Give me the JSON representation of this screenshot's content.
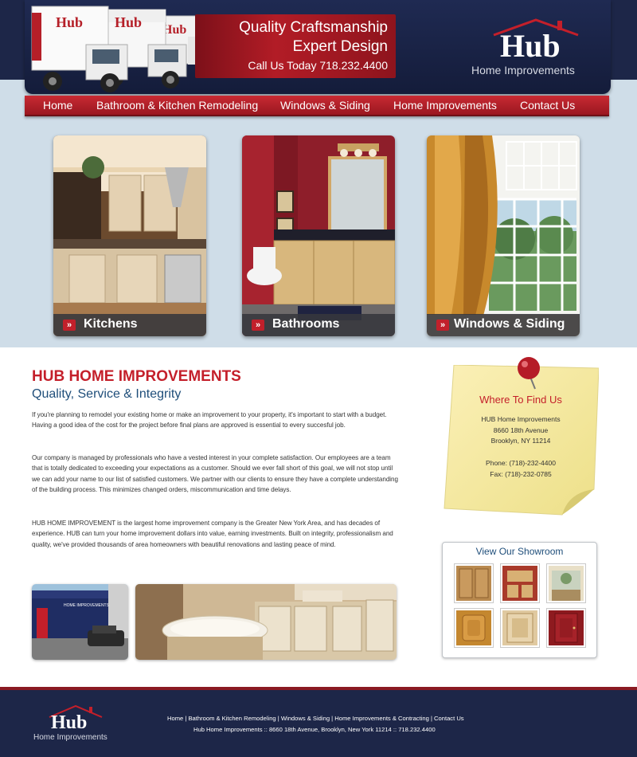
{
  "colors": {
    "navy": "#1d2648",
    "red": "#c41f2a",
    "nav_red": "#b3222b",
    "blue_heading": "#1f4e7a",
    "light_band": "#cfdde8"
  },
  "header": {
    "promo": {
      "line1": "Quality Craftsmanship",
      "line2": "Expert Design",
      "line3": "Call Us Today 718.232.4400"
    },
    "truck_text": "Hub",
    "logo": {
      "name": "Hub",
      "tagline": "Home Improvements"
    }
  },
  "nav": {
    "items": [
      {
        "label": "Home"
      },
      {
        "label": "Bathroom & Kitchen Remodeling"
      },
      {
        "label": "Windows & Siding"
      },
      {
        "label": "Home Improvements"
      },
      {
        "label": "Contact Us"
      }
    ]
  },
  "features": [
    {
      "label": "Kitchens",
      "icon": "double-chevron-right-icon"
    },
    {
      "label": "Bathrooms",
      "icon": "double-chevron-right-icon"
    },
    {
      "label": "Windows & Siding",
      "icon": "double-chevron-right-icon"
    }
  ],
  "main": {
    "title": "HUB HOME IMPROVEMENTS",
    "subtitle": "Quality, Service & Integrity",
    "paragraphs": [
      "If you're planning to remodel your existing home or make an improvement to your property, it's important to start with a budget. Having a good idea of the cost for the project before final plans are approved is essential to every succesful job.",
      "Our company is managed by professionals who have a vested interest in your complete satisfaction. Our employees are a team that is totally dedicated to exceeding your expectations as a customer. Should we ever fall short of this goal, we will not stop until we can add your name to our list of satisfied customers. We partner with our clients to ensure they have a complete understanding of the building process. This minimizes changed orders, miscommunication and time delays.",
      "HUB HOME IMPROVEMENT is the largest home improvement company is the Greater New York Area, and has decades of experience. HUB can turn your home improvement dollars into value, earning investments. Built on integrity, professionalism and quality, we've provided thousands of area homeowners with beautiful renovations and lasting peace of mind."
    ]
  },
  "find_us": {
    "title": "Where To Find Us",
    "name": "HUB Home Improvements",
    "street": "8660 18th Avenue",
    "city": "Brooklyn, NY 11214",
    "phone": "Phone: (718)-232-4400",
    "fax": "Fax: (718)-232-0785"
  },
  "showroom": {
    "title": "View Our Showroom",
    "thumb_count": 6
  },
  "footer": {
    "links": [
      "Home",
      "Bathroom & Kitchen Remodeling",
      "Windows & Siding",
      "Home Improvements & Contracting",
      "Contact Us"
    ],
    "separator": " | ",
    "address": "Hub Home Improvements :: 8660 18th Avenue, Brooklyn, New York 11214 :: 718.232.4400",
    "logo": {
      "name": "Hub",
      "tagline": "Home Improvements"
    }
  }
}
